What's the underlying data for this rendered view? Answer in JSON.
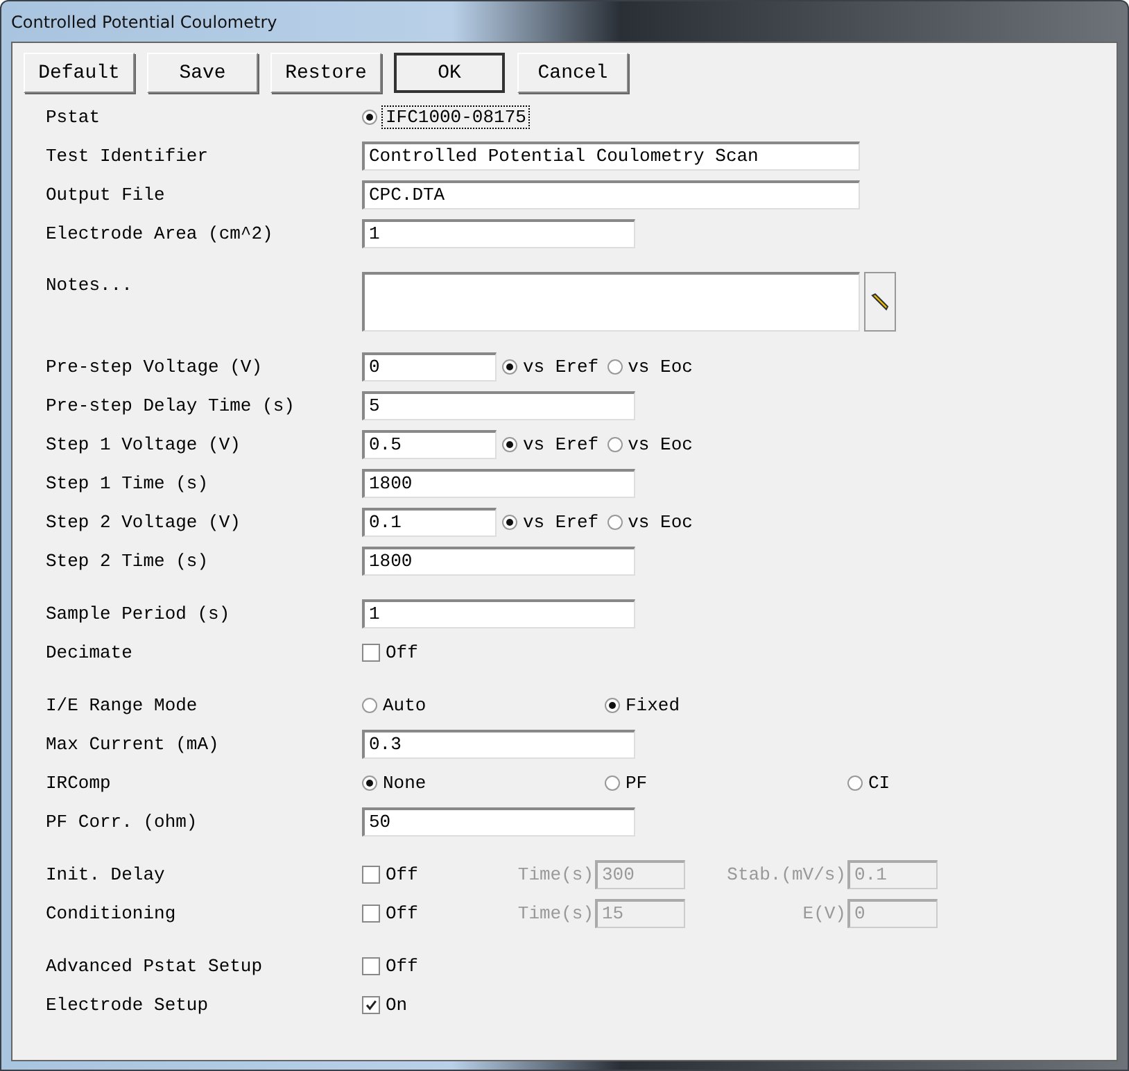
{
  "window": {
    "title": "Controlled Potential Coulometry"
  },
  "buttons": [
    {
      "label": "Default",
      "default": false
    },
    {
      "label": "Save",
      "default": false
    },
    {
      "label": "Restore",
      "default": false
    },
    {
      "label": "OK",
      "default": true
    },
    {
      "label": "Cancel",
      "default": false
    }
  ],
  "sections": [
    {
      "rows": [
        {
          "kind": "choice",
          "label": "Pstat",
          "options": [
            {
              "label": "IFC1000-08175",
              "selected": true,
              "focused": true
            }
          ]
        },
        {
          "kind": "text_long",
          "label": "Test Identifier",
          "value": "Controlled Potential Coulometry Scan"
        },
        {
          "kind": "text_long",
          "label": "Output File",
          "value": "CPC.DTA"
        },
        {
          "kind": "text",
          "label": "Electrode Area (cm^2)",
          "value": "1"
        },
        {
          "kind": "notes",
          "label": "Notes..."
        }
      ]
    },
    {
      "rows": [
        {
          "kind": "voltage",
          "label": "Pre-step Voltage (V)",
          "value": "0",
          "options": [
            {
              "label": "vs Eref",
              "selected": true
            },
            {
              "label": "vs Eoc",
              "selected": false
            }
          ]
        },
        {
          "kind": "text",
          "label": "Pre-step Delay Time (s)",
          "value": "5"
        },
        {
          "kind": "voltage",
          "label": "Step 1 Voltage (V)",
          "value": "0.5",
          "options": [
            {
              "label": "vs Eref",
              "selected": true
            },
            {
              "label": "vs Eoc",
              "selected": false
            }
          ]
        },
        {
          "kind": "text",
          "label": "Step 1 Time (s)",
          "value": "1800"
        },
        {
          "kind": "voltage",
          "label": "Step 2 Voltage (V)",
          "value": "0.1",
          "options": [
            {
              "label": "vs Eref",
              "selected": true
            },
            {
              "label": "vs Eoc",
              "selected": false
            }
          ]
        },
        {
          "kind": "text",
          "label": "Step 2 Time (s)",
          "value": "1800"
        }
      ]
    },
    {
      "rows": [
        {
          "kind": "text",
          "label": "Sample Period (s)",
          "value": "1"
        },
        {
          "kind": "checkbox",
          "label": "Decimate",
          "checked": false,
          "state": "Off"
        }
      ]
    },
    {
      "rows": [
        {
          "kind": "choice",
          "label": "I/E Range Mode",
          "options": [
            {
              "label": "Auto",
              "selected": false
            },
            {
              "label": "Fixed",
              "selected": true
            }
          ]
        },
        {
          "kind": "text",
          "label": "Max Current (mA)",
          "value": "0.3"
        },
        {
          "kind": "choice",
          "label": "IRComp",
          "options": [
            {
              "label": "None",
              "selected": true
            },
            {
              "label": "PF",
              "selected": false
            },
            {
              "label": "CI",
              "selected": false
            }
          ]
        },
        {
          "kind": "text",
          "label": "PF Corr. (ohm)",
          "value": "50"
        }
      ]
    },
    {
      "rows": [
        {
          "kind": "checkbox",
          "label": "Init. Delay",
          "checked": false,
          "state": "Off",
          "extras": [
            {
              "label": "Time(s)",
              "value": "300",
              "disabled": true
            },
            {
              "label": "Stab.(mV/s)",
              "value": "0.1",
              "disabled": true
            }
          ]
        },
        {
          "kind": "checkbox",
          "label": "Conditioning",
          "checked": false,
          "state": "Off",
          "extras": [
            {
              "label": "Time(s)",
              "value": "15",
              "disabled": true
            },
            {
              "label": "E(V)",
              "value": "0",
              "disabled": true
            }
          ]
        }
      ]
    },
    {
      "rows": [
        {
          "kind": "checkbox",
          "label": "Advanced Pstat Setup",
          "checked": false,
          "state": "Off"
        },
        {
          "kind": "checkbox",
          "label": "Electrode Setup",
          "checked": true,
          "state": "On"
        }
      ]
    }
  ]
}
